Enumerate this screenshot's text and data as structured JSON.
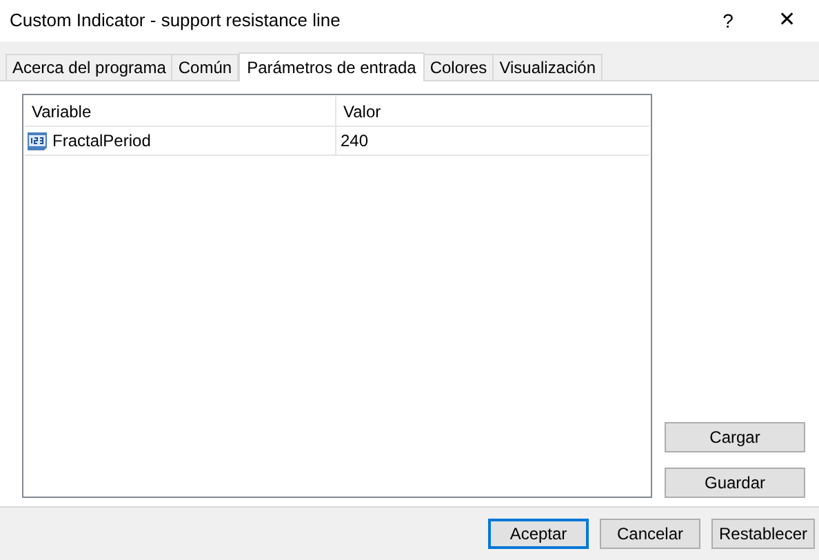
{
  "window": {
    "title": "Custom Indicator - support resistance line",
    "help": "?",
    "close": "✕"
  },
  "tabs": [
    {
      "label": "Acerca del programa",
      "selected": false
    },
    {
      "label": "Común",
      "selected": false
    },
    {
      "label": "Parámetros de entrada",
      "selected": true
    },
    {
      "label": "Colores",
      "selected": false
    },
    {
      "label": "Visualización",
      "selected": false
    }
  ],
  "table": {
    "columns": [
      "Variable",
      "Valor"
    ],
    "rows": [
      {
        "variable": "FractalPeriod",
        "value": "240",
        "kind": "integer"
      }
    ]
  },
  "side_buttons": [
    "Cargar",
    "Guardar"
  ],
  "buttons": [
    {
      "label": "Aceptar",
      "default": true
    },
    {
      "label": "Cancelar",
      "default": false
    },
    {
      "label": "Restablecer",
      "default": false
    }
  ]
}
